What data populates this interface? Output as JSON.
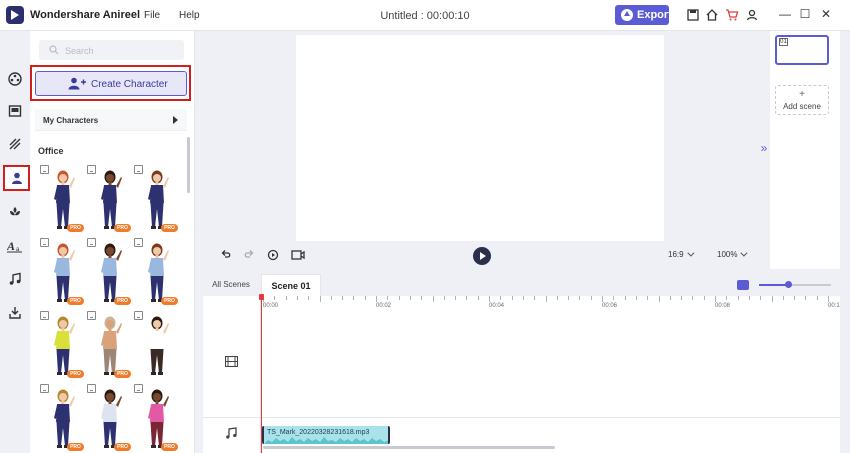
{
  "app": {
    "name": "Wondershare Anireel",
    "menu": [
      "File",
      "Help"
    ],
    "doc_title": "Untitled : 00:00:10",
    "export_label": "Export"
  },
  "panel": {
    "search_placeholder": "Search",
    "create_label": "Create Character",
    "my_characters_label": "My Characters",
    "section_title": "Office",
    "badge": "PRO",
    "characters": [
      {
        "skin": "#f0c9a8",
        "hair": "#c7552d",
        "top": "#2d3170",
        "bottom": "#2d3170",
        "pro": true
      },
      {
        "skin": "#7a4a2f",
        "hair": "#2a1a12",
        "top": "#2d3170",
        "bottom": "#2d3170",
        "pro": true
      },
      {
        "skin": "#f0c9a8",
        "hair": "#7a3a1e",
        "top": "#2d3170",
        "bottom": "#2d3170",
        "pro": true
      },
      {
        "skin": "#f0c9a8",
        "hair": "#c7552d",
        "top": "#9ab8de",
        "bottom": "#2d3170",
        "pro": true
      },
      {
        "skin": "#7a4a2f",
        "hair": "#2a1a12",
        "top": "#9ab8de",
        "bottom": "#2d3170",
        "pro": true
      },
      {
        "skin": "#f0c9a8",
        "hair": "#7a3a1e",
        "top": "#9ab8de",
        "bottom": "#2d3170",
        "pro": true
      },
      {
        "skin": "#f0c9a8",
        "hair": "#b8862d",
        "top": "#d9e03a",
        "bottom": "#2d3170",
        "pro": true
      },
      {
        "skin": "#d9a27b",
        "hair": "#c9b79a",
        "top": "#d9a27b",
        "bottom": "#9b8678",
        "pro": true
      },
      {
        "skin": "#f0c9a8",
        "hair": "#2a1a12",
        "top": "#ffffff",
        "bottom": "#3a2a25",
        "pro": false
      },
      {
        "skin": "#f0c9a8",
        "hair": "#b8862d",
        "top": "#2d3170",
        "bottom": "#2d3170",
        "pro": true
      },
      {
        "skin": "#7a4a2f",
        "hair": "#2a1a12",
        "top": "#dde3ef",
        "bottom": "#2d3170",
        "pro": true
      },
      {
        "skin": "#7a4a2f",
        "hair": "#2a1a12",
        "top": "#e25aa4",
        "bottom": "#7a2636",
        "pro": true
      }
    ]
  },
  "canvas": {
    "ratio": "16:9",
    "zoom": "100%"
  },
  "scenes": {
    "thumb_num": "01",
    "add_label": "Add scene"
  },
  "timeline": {
    "tabs": [
      "All Scenes",
      "Scene 01"
    ],
    "ticks": [
      "00:00",
      "00:02",
      "00:04",
      "00:06",
      "00:08",
      "00:1"
    ],
    "audio_clip": "TS_Mark_20220328231618.mp3"
  },
  "colors": {
    "accent": "#5b5bd6",
    "highlight": "#d11f1f",
    "pro_badge": "#f07b2a"
  }
}
